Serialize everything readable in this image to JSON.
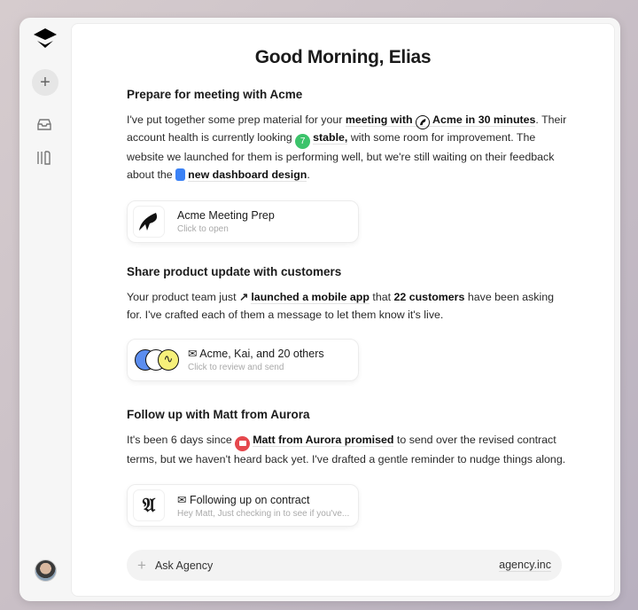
{
  "greeting": "Good Morning, Elias",
  "sections": [
    {
      "heading": "Prepare for meeting with Acme",
      "t1": "I've put together some prep material for your ",
      "b1": "meeting with",
      "b2": "Acme in 30 minutes",
      "t2": ". Their account health is currently looking ",
      "score": "7",
      "b3": "stable,",
      "t3": " with some room for improvement. The website we launched for them is performing well, but we're still waiting on their feedback about the ",
      "b4": "new dashboard design",
      "t4": ".",
      "card": {
        "title": "Acme Meeting Prep",
        "subtitle": "Click to open"
      }
    },
    {
      "heading": "Share product update with customers",
      "t1": "Your product team just ",
      "b1": "launched a mobile app",
      "t2": " that ",
      "b2": "22 customers",
      "t3": " have been asking for. I've crafted each of them a message to let them know it's live.",
      "card": {
        "title": "Acme, Kai, and 20 others",
        "subtitle": "Click to review and send"
      }
    },
    {
      "heading": "Follow up with Matt from Aurora",
      "t1": "It's been 6 days since ",
      "b1": "Matt from Aurora promised",
      "t2": " to send over the revised contract terms, but we haven't heard back yet. I've drafted a gentle reminder to nudge things along.",
      "card": {
        "title": "Following up on contract",
        "subtitle": "Hey Matt, Just checking in to see if you've..."
      }
    }
  ],
  "ask": {
    "placeholder": "Ask Agency",
    "brand": "agency.inc"
  },
  "colors": {
    "score": "#3cc36b",
    "doc": "#3b82f6",
    "aurora": "#e5484d",
    "accent_yellow": "#f6f07a"
  }
}
